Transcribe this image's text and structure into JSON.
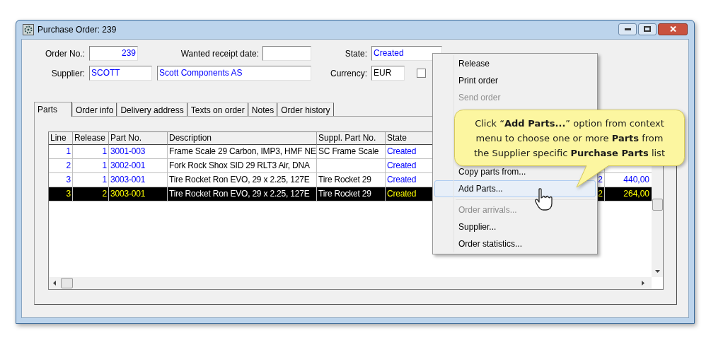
{
  "window": {
    "title": "Purchase Order: 239"
  },
  "form": {
    "order_no": {
      "label": "Order No.:",
      "value": "239"
    },
    "wanted_receipt_date": {
      "label": "Wanted receipt date:"
    },
    "state": {
      "label": "State:",
      "value": "Created"
    },
    "supplier": {
      "label": "Supplier:",
      "code": "SCOTT",
      "name": "Scott Components AS"
    },
    "currency": {
      "label": "Currency:",
      "value": "EUR"
    },
    "checkbox": {
      "checked": false
    }
  },
  "tabs": [
    {
      "label": "Parts",
      "selected": true
    },
    {
      "label": "Order info",
      "selected": false
    },
    {
      "label": "Delivery address",
      "selected": false
    },
    {
      "label": "Texts on order",
      "selected": false
    },
    {
      "label": "Notes",
      "selected": false
    },
    {
      "label": "Order history",
      "selected": false
    }
  ],
  "table": {
    "columns": [
      "Line",
      "Release",
      "Part No.",
      "Description",
      "Suppl. Part No.",
      "State"
    ],
    "rows": [
      {
        "line": "1",
        "release": "1",
        "part_no": "3001-003",
        "description": "Frame Scale 29 Carbon, IMP3, HMF NE",
        "suppl_part_no": "SC Frame Scale",
        "state": "Created",
        "selected": false
      },
      {
        "line": "2",
        "release": "1",
        "part_no": "3002-001",
        "description": "Fork Rock Shox SID 29 RLT3 Air, DNA",
        "state": "Created",
        "selected": false
      },
      {
        "line": "3",
        "release": "1",
        "part_no": "3003-001",
        "description": "Tire Rocket Ron EVO, 29 x 2.25, 127E",
        "suppl_part_no": "Tire Rocket 29",
        "state": "Created",
        "column_7": "2",
        "column_8": "440,00",
        "selected": false
      },
      {
        "line": "3",
        "release": "2",
        "part_no": "3003-001",
        "description": "Tire Rocket Ron EVO, 29 x 2.25, 127E",
        "suppl_part_no": "Tire Rocket 29",
        "state": "Created",
        "column_7": "2",
        "column_8": "264,00",
        "selected": true
      }
    ]
  },
  "context_menu": {
    "items": [
      {
        "kind": "item",
        "label": "Release",
        "disabled": false,
        "selected": false
      },
      {
        "kind": "item",
        "label": "Print order",
        "disabled": false,
        "selected": false
      },
      {
        "kind": "item",
        "label": "Send order",
        "disabled": true,
        "selected": false
      },
      {
        "kind": "hidden"
      },
      {
        "kind": "item",
        "label": "Copy parts from...",
        "disabled": false,
        "selected": false
      },
      {
        "kind": "item",
        "label": "Add Parts...",
        "disabled": false,
        "selected": true
      },
      {
        "kind": "separator"
      },
      {
        "kind": "item",
        "label": "Order arrivals...",
        "disabled": true,
        "selected": false
      },
      {
        "kind": "item",
        "label": "Supplier...",
        "disabled": false,
        "selected": false
      },
      {
        "kind": "item",
        "label": "Order statistics...",
        "disabled": false,
        "selected": false
      }
    ]
  },
  "callout": {
    "text": "Click “**Add Parts...**” option from context menu to choose one or more **Parts** from the Supplier specific **Purchase Parts** list"
  }
}
